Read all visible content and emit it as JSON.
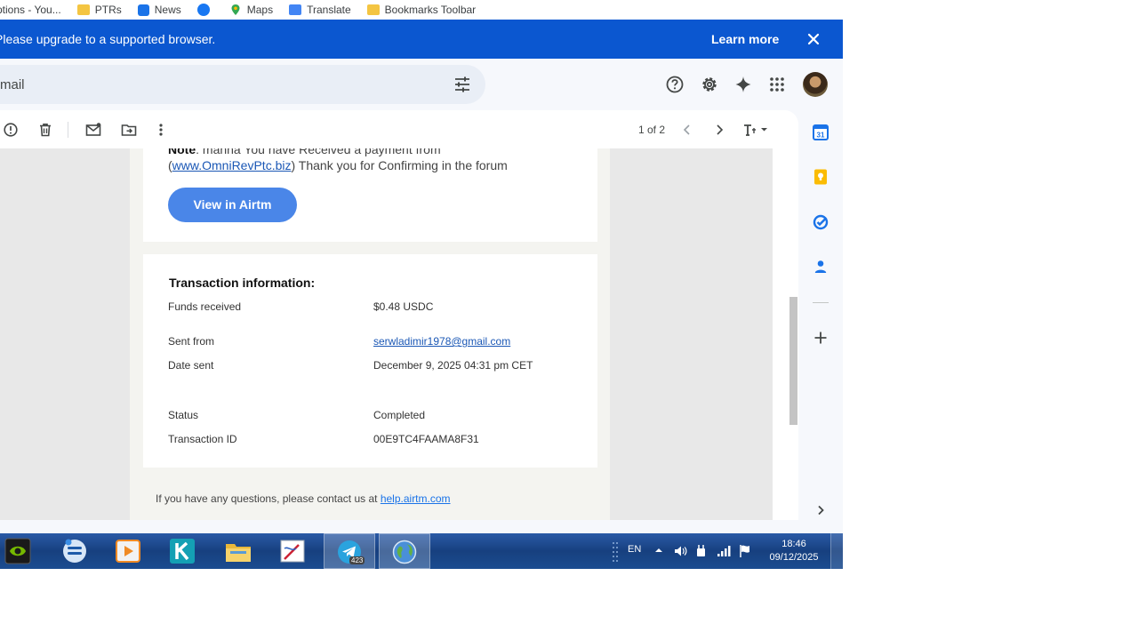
{
  "bookmarks": [
    {
      "label": "ptions - You..."
    },
    {
      "label": "PTRs"
    },
    {
      "label": "News"
    },
    {
      "label": ""
    },
    {
      "label": "Maps"
    },
    {
      "label": "Translate"
    },
    {
      "label": "Bookmarks Toolbar"
    }
  ],
  "banner": {
    "text": "Please upgrade to a supported browser.",
    "link": "Learn more"
  },
  "search": {
    "placeholder": "mail"
  },
  "toolbar": {
    "pager": "1 of 2"
  },
  "email": {
    "note_label": "Note",
    "note_text": ": manna You have Received a payment from",
    "note_paren_open": "(",
    "note_link": "www.OmniRevPtc.biz",
    "note_after": ") Thank you for Confirming in the forum",
    "view_button": "View in Airtm",
    "tx_title": "Transaction information:",
    "rows": [
      {
        "label": "Funds received",
        "value": "$0.48 USDC"
      },
      {
        "label": "Sent from",
        "value": "serwladimir1978@gmail.com"
      },
      {
        "label": "Date sent",
        "value": "December 9, 2025 04:31 pm CET"
      },
      {
        "label": "Status",
        "value": "Completed"
      },
      {
        "label": "Transaction ID",
        "value": "00E9TC4FAAMA8F31"
      }
    ],
    "footer_text": "If you have any questions, please contact us at ",
    "footer_link": "help.airtm.com"
  },
  "taskbar": {
    "telegram_badge": "423",
    "lang": "EN",
    "time": "18:46",
    "date": "09/12/2025"
  },
  "colors": {
    "banner": "#0b57d0",
    "button": "#4a86e8",
    "link": "#1a57b5"
  }
}
